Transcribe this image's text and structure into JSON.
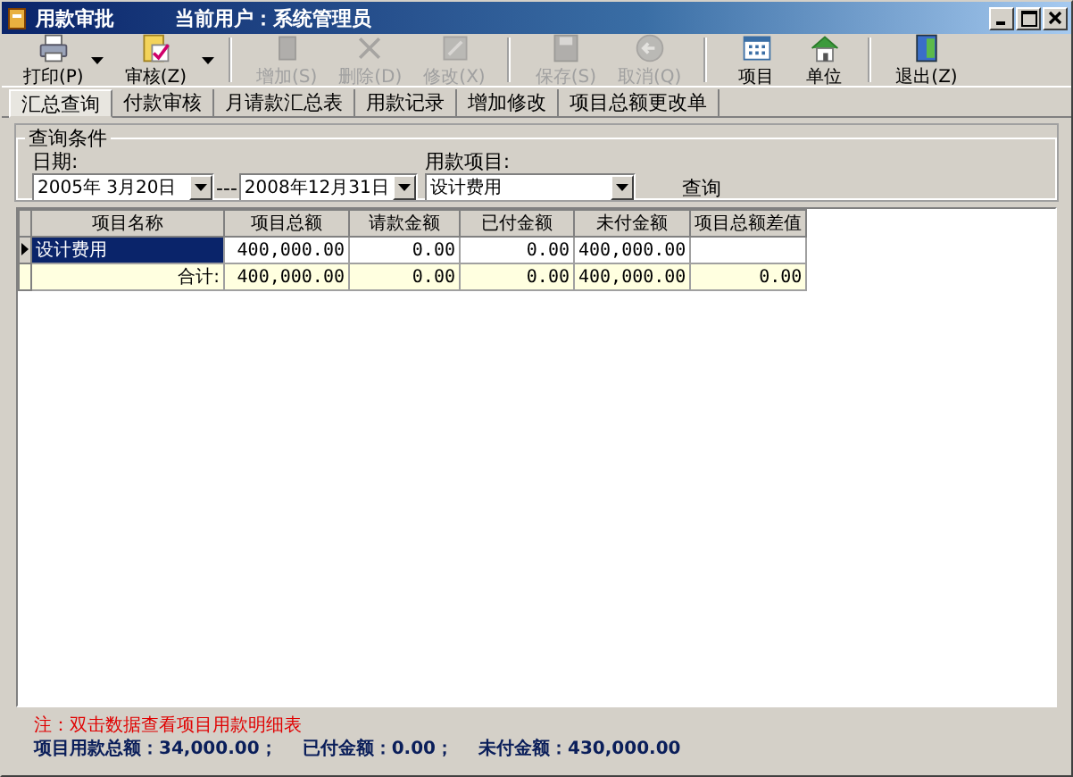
{
  "window": {
    "title": "用款审批",
    "current_user": "当前用户：系统管理员"
  },
  "toolbar": [
    {
      "label": "打印(P)",
      "kind": "printer",
      "dropdown": true,
      "disabled": false,
      "group_end": false
    },
    {
      "label": "审核(Z)",
      "kind": "approve",
      "dropdown": true,
      "disabled": false,
      "group_end": true
    },
    {
      "label": "增加(S)",
      "kind": "add",
      "dropdown": false,
      "disabled": true,
      "group_end": false
    },
    {
      "label": "删除(D)",
      "kind": "delete",
      "dropdown": false,
      "disabled": true,
      "group_end": false
    },
    {
      "label": "修改(X)",
      "kind": "edit",
      "dropdown": false,
      "disabled": true,
      "group_end": true
    },
    {
      "label": "保存(S)",
      "kind": "save",
      "dropdown": false,
      "disabled": true,
      "group_end": false
    },
    {
      "label": "取消(Q)",
      "kind": "cancel",
      "dropdown": false,
      "disabled": true,
      "group_end": true
    },
    {
      "label": "项目",
      "kind": "project",
      "dropdown": false,
      "disabled": false,
      "group_end": false
    },
    {
      "label": "单位",
      "kind": "unit",
      "dropdown": false,
      "disabled": false,
      "group_end": true
    },
    {
      "label": "退出(Z)",
      "kind": "exit",
      "dropdown": false,
      "disabled": false,
      "group_end": false
    }
  ],
  "tabs": [
    {
      "label": "汇总查询",
      "selected": true
    },
    {
      "label": "付款审核",
      "selected": false
    },
    {
      "label": "月请款汇总表",
      "selected": false
    },
    {
      "label": "用款记录",
      "selected": false
    },
    {
      "label": "增加修改",
      "selected": false
    },
    {
      "label": "项目总额更改单",
      "selected": false
    }
  ],
  "query": {
    "group_title": "查询条件",
    "date_label": "日期:",
    "date_from": "2005年 3月20日",
    "date_separator": "---",
    "date_to": "2008年12月31日",
    "item_label": "用款项目:",
    "item_value": "设计费用",
    "query_button": "查询"
  },
  "grid": {
    "columns": [
      "项目名称",
      "项目总额",
      "请款金额",
      "已付金额",
      "未付金额",
      "项目总额差值"
    ],
    "rows": [
      {
        "selected": true,
        "cells": [
          "设计费用",
          "400,000.00",
          "0.00",
          "0.00",
          "400,000.00",
          ""
        ]
      }
    ],
    "total": {
      "label": "合计:",
      "cells": [
        "400,000.00",
        "0.00",
        "0.00",
        "400,000.00",
        "0.00"
      ]
    }
  },
  "note": "注：双击数据查看项目用款明细表",
  "summary": [
    "项目用款总额：34,000.00；",
    "已付金额：0.00；",
    "未付金额：430,000.00"
  ]
}
